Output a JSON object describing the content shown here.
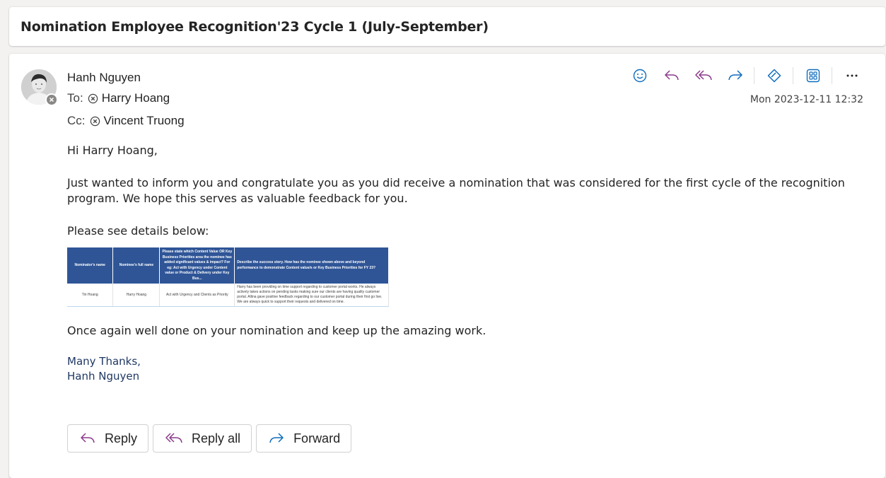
{
  "subject": "Nomination Employee Recognition'23 Cycle 1 (July-September)",
  "message": {
    "sender": "Hanh Nguyen",
    "to_label": "To:",
    "to": "Harry Hoang",
    "cc_label": "Cc:",
    "cc": "Vincent Truong",
    "date": "Mon 2023-12-11 12:32"
  },
  "toolbar": {
    "icons": [
      "emoji-icon",
      "reply-icon",
      "reply-all-icon",
      "forward-icon",
      "tag-icon",
      "apps-icon",
      "more-icon"
    ]
  },
  "body": {
    "greeting": "Hi Harry Hoang,",
    "para1": "Just wanted to inform you and congratulate you as you did receive a nomination that was considered for the first cycle of the recognition program. We hope this serves as valuable feedback for you.",
    "para2": "Please see details below:",
    "para3": "Once again well done on your nomination and keep up the amazing work.",
    "sign_off": "Many Thanks,",
    "sign_name": "Hanh Nguyen"
  },
  "table": {
    "headers": [
      "Nominator's name",
      "Nominee's full name",
      "Please state which Content Value OR Key Business Priorities area the nominee has added significant values & impact? For eg: Act with Urgency under Content value or Product & Delivery under Key Bus...",
      "Describe the success story. How has the nominee shown above and beyond performance to demonstrate Content value/s or Key Business Priorities for FY 23?"
    ],
    "row": [
      "Tin Hoang",
      "Harry Hoang",
      "Act with Urgency and Clients as Priority",
      "Harry has been providing on time support regarding to customer portal works. He always actively takes actions on pending tasks making sure our clients are having quality customer portal. Allina gave positive feedback regarding to our customer portal during their first go live. We are always quick to support their requests and delivered on time."
    ]
  },
  "actions": {
    "reply": "Reply",
    "reply_all": "Reply all",
    "forward": "Forward"
  },
  "colors": {
    "accent": "#0f6cbd",
    "reply_purple": "#8a3a8a",
    "table_header": "#2f5597"
  }
}
